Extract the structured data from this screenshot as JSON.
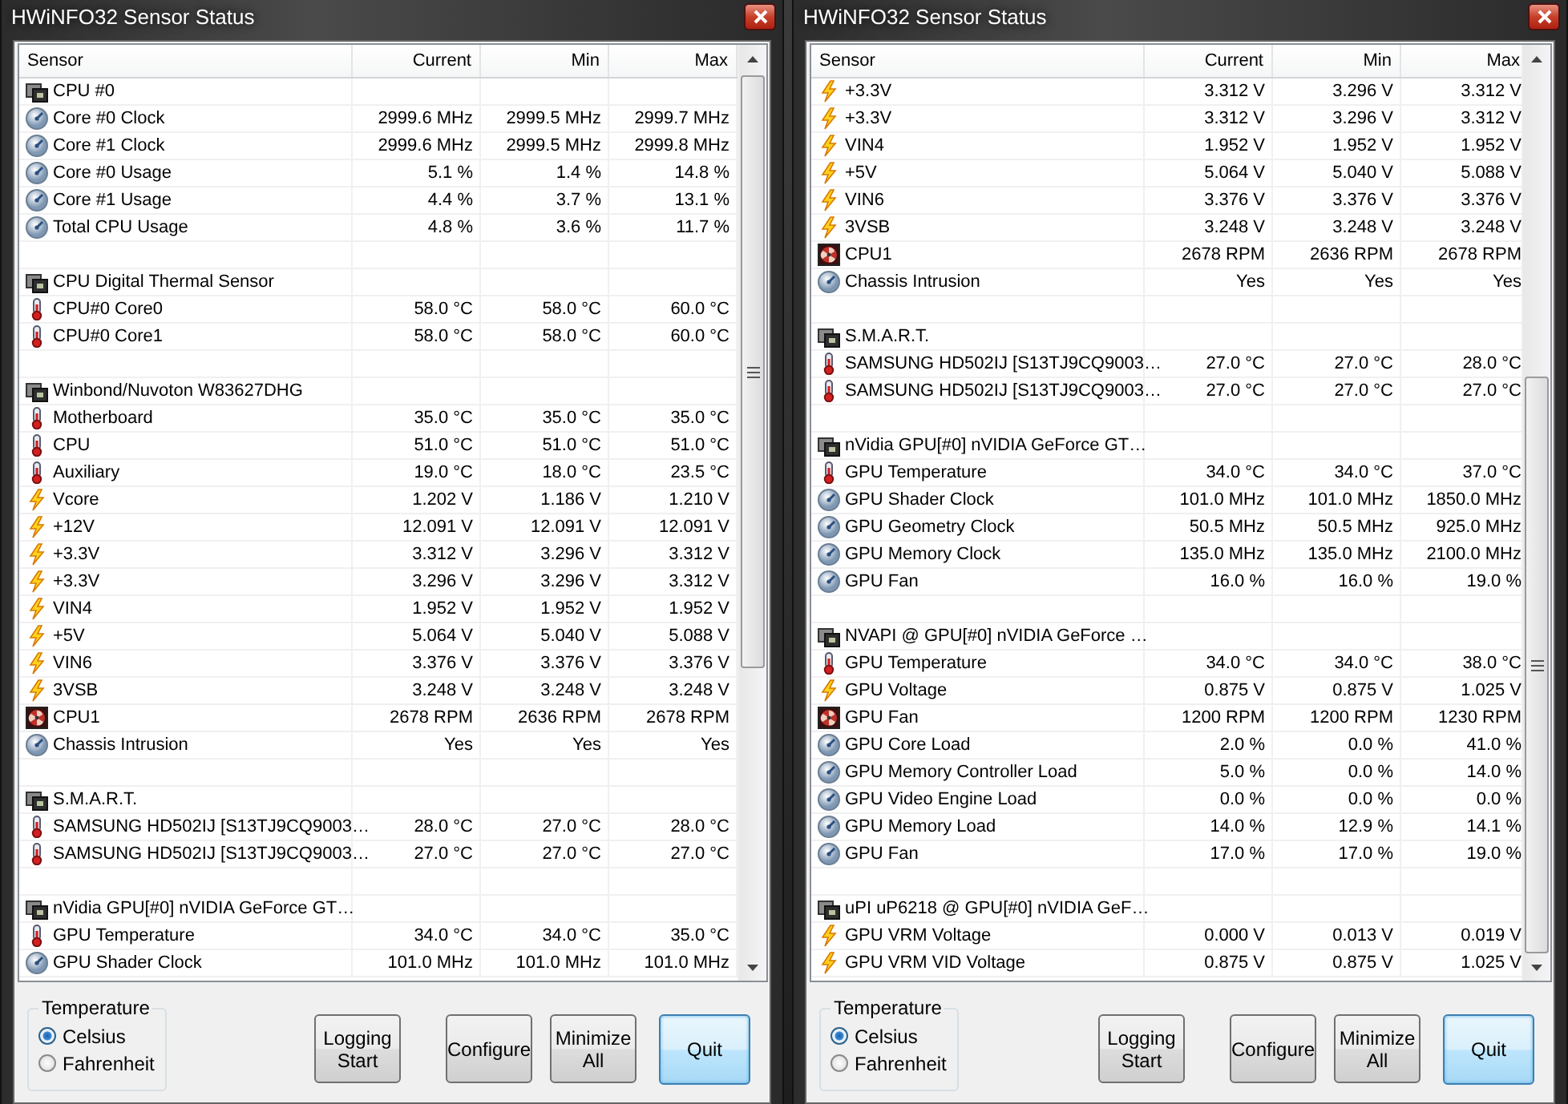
{
  "windows": [
    {
      "title": "HWiNFO32 Sensor Status",
      "columns": [
        "Sensor",
        "Current",
        "Min",
        "Max"
      ],
      "rows": [
        {
          "kind": "group",
          "label": "CPU #0"
        },
        {
          "kind": "gauge",
          "label": "Core #0 Clock",
          "values": [
            "2999.6 MHz",
            "2999.5 MHz",
            "2999.7 MHz"
          ]
        },
        {
          "kind": "gauge",
          "label": "Core #1 Clock",
          "values": [
            "2999.6 MHz",
            "2999.5 MHz",
            "2999.8 MHz"
          ]
        },
        {
          "kind": "gauge",
          "label": "Core #0 Usage",
          "values": [
            "5.1 %",
            "1.4 %",
            "14.8 %"
          ]
        },
        {
          "kind": "gauge",
          "label": "Core #1 Usage",
          "values": [
            "4.4 %",
            "3.7 %",
            "13.1 %"
          ]
        },
        {
          "kind": "gauge",
          "label": "Total CPU Usage",
          "values": [
            "4.8 %",
            "3.6 %",
            "11.7 %"
          ]
        },
        {
          "kind": "blank"
        },
        {
          "kind": "group",
          "label": "CPU Digital Thermal Sensor"
        },
        {
          "kind": "thermo",
          "label": "CPU#0 Core0",
          "values": [
            "58.0 °C",
            "58.0 °C",
            "60.0 °C"
          ]
        },
        {
          "kind": "thermo",
          "label": "CPU#0 Core1",
          "values": [
            "58.0 °C",
            "58.0 °C",
            "60.0 °C"
          ]
        },
        {
          "kind": "blank"
        },
        {
          "kind": "group",
          "label": "Winbond/Nuvoton W83627DHG"
        },
        {
          "kind": "thermo",
          "label": "Motherboard",
          "values": [
            "35.0 °C",
            "35.0 °C",
            "35.0 °C"
          ]
        },
        {
          "kind": "thermo",
          "label": "CPU",
          "values": [
            "51.0 °C",
            "51.0 °C",
            "51.0 °C"
          ]
        },
        {
          "kind": "thermo",
          "label": "Auxiliary",
          "values": [
            "19.0 °C",
            "18.0 °C",
            "23.5 °C"
          ]
        },
        {
          "kind": "volt",
          "label": "Vcore",
          "values": [
            "1.202 V",
            "1.186 V",
            "1.210 V"
          ]
        },
        {
          "kind": "volt",
          "label": "+12V",
          "values": [
            "12.091 V",
            "12.091 V",
            "12.091 V"
          ]
        },
        {
          "kind": "volt",
          "label": "+3.3V",
          "values": [
            "3.312 V",
            "3.296 V",
            "3.312 V"
          ]
        },
        {
          "kind": "volt",
          "label": "+3.3V",
          "values": [
            "3.296 V",
            "3.296 V",
            "3.312 V"
          ]
        },
        {
          "kind": "volt",
          "label": "VIN4",
          "values": [
            "1.952 V",
            "1.952 V",
            "1.952 V"
          ]
        },
        {
          "kind": "volt",
          "label": "+5V",
          "values": [
            "5.064 V",
            "5.040 V",
            "5.088 V"
          ]
        },
        {
          "kind": "volt",
          "label": "VIN6",
          "values": [
            "3.376 V",
            "3.376 V",
            "3.376 V"
          ]
        },
        {
          "kind": "volt",
          "label": "3VSB",
          "values": [
            "3.248 V",
            "3.248 V",
            "3.248 V"
          ]
        },
        {
          "kind": "fan",
          "label": "CPU1",
          "values": [
            "2678 RPM",
            "2636 RPM",
            "2678 RPM"
          ]
        },
        {
          "kind": "gauge",
          "label": "Chassis Intrusion",
          "values": [
            "Yes",
            "Yes",
            "Yes"
          ]
        },
        {
          "kind": "blank"
        },
        {
          "kind": "group",
          "label": "S.M.A.R.T."
        },
        {
          "kind": "thermo",
          "label": "SAMSUNG HD502IJ [S13TJ9CQ9003…",
          "values": [
            "28.0 °C",
            "27.0 °C",
            "28.0 °C"
          ]
        },
        {
          "kind": "thermo",
          "label": "SAMSUNG HD502IJ [S13TJ9CQ9003…",
          "values": [
            "27.0 °C",
            "27.0 °C",
            "27.0 °C"
          ]
        },
        {
          "kind": "blank"
        },
        {
          "kind": "group",
          "label": "nVidia GPU[#0] nVIDIA GeForce GT…"
        },
        {
          "kind": "thermo",
          "label": "GPU Temperature",
          "values": [
            "34.0 °C",
            "34.0 °C",
            "35.0 °C"
          ]
        },
        {
          "kind": "gauge",
          "label": "GPU Shader Clock",
          "values": [
            "101.0 MHz",
            "101.0 MHz",
            "101.0 MHz"
          ]
        }
      ],
      "temperature": {
        "label": "Temperature",
        "options": [
          {
            "label": "Celsius",
            "selected": true
          },
          {
            "label": "Fahrenheit",
            "selected": false
          }
        ]
      },
      "buttons": [
        {
          "lines": [
            "Logging",
            "Start"
          ],
          "focused": false
        },
        {
          "lines": [
            "Configure"
          ],
          "focused": false
        },
        {
          "lines": [
            "Minimize",
            "All"
          ],
          "focused": false
        },
        {
          "lines": [
            "Quit"
          ],
          "focused": true
        }
      ]
    },
    {
      "title": "HWiNFO32 Sensor Status",
      "columns": [
        "Sensor",
        "Current",
        "Min",
        "Max"
      ],
      "rows": [
        {
          "kind": "volt",
          "label": "+3.3V",
          "values": [
            "3.312 V",
            "3.296 V",
            "3.312 V"
          ]
        },
        {
          "kind": "volt",
          "label": "+3.3V",
          "values": [
            "3.312 V",
            "3.296 V",
            "3.312 V"
          ]
        },
        {
          "kind": "volt",
          "label": "VIN4",
          "values": [
            "1.952 V",
            "1.952 V",
            "1.952 V"
          ]
        },
        {
          "kind": "volt",
          "label": "+5V",
          "values": [
            "5.064 V",
            "5.040 V",
            "5.088 V"
          ]
        },
        {
          "kind": "volt",
          "label": "VIN6",
          "values": [
            "3.376 V",
            "3.376 V",
            "3.376 V"
          ]
        },
        {
          "kind": "volt",
          "label": "3VSB",
          "values": [
            "3.248 V",
            "3.248 V",
            "3.248 V"
          ]
        },
        {
          "kind": "fan",
          "label": "CPU1",
          "values": [
            "2678 RPM",
            "2636 RPM",
            "2678 RPM"
          ]
        },
        {
          "kind": "gauge",
          "label": "Chassis Intrusion",
          "values": [
            "Yes",
            "Yes",
            "Yes"
          ]
        },
        {
          "kind": "blank"
        },
        {
          "kind": "group",
          "label": "S.M.A.R.T."
        },
        {
          "kind": "thermo",
          "label": "SAMSUNG HD502IJ [S13TJ9CQ9003…",
          "values": [
            "27.0 °C",
            "27.0 °C",
            "28.0 °C"
          ]
        },
        {
          "kind": "thermo",
          "label": "SAMSUNG HD502IJ [S13TJ9CQ9003…",
          "values": [
            "27.0 °C",
            "27.0 °C",
            "27.0 °C"
          ]
        },
        {
          "kind": "blank"
        },
        {
          "kind": "group",
          "label": "nVidia GPU[#0] nVIDIA GeForce GT…"
        },
        {
          "kind": "thermo",
          "label": "GPU Temperature",
          "values": [
            "34.0 °C",
            "34.0 °C",
            "37.0 °C"
          ]
        },
        {
          "kind": "gauge",
          "label": "GPU Shader Clock",
          "values": [
            "101.0 MHz",
            "101.0 MHz",
            "1850.0 MHz"
          ]
        },
        {
          "kind": "gauge",
          "label": "GPU Geometry Clock",
          "values": [
            "50.5 MHz",
            "50.5 MHz",
            "925.0 MHz"
          ]
        },
        {
          "kind": "gauge",
          "label": "GPU Memory Clock",
          "values": [
            "135.0 MHz",
            "135.0 MHz",
            "2100.0 MHz"
          ]
        },
        {
          "kind": "gauge",
          "label": "GPU Fan",
          "values": [
            "16.0 %",
            "16.0 %",
            "19.0 %"
          ]
        },
        {
          "kind": "blank"
        },
        {
          "kind": "group",
          "label": "NVAPI @ GPU[#0] nVIDIA GeForce …"
        },
        {
          "kind": "thermo",
          "label": "GPU Temperature",
          "values": [
            "34.0 °C",
            "34.0 °C",
            "38.0 °C"
          ]
        },
        {
          "kind": "volt",
          "label": "GPU Voltage",
          "values": [
            "0.875 V",
            "0.875 V",
            "1.025 V"
          ]
        },
        {
          "kind": "fan",
          "label": "GPU Fan",
          "values": [
            "1200 RPM",
            "1200 RPM",
            "1230 RPM"
          ]
        },
        {
          "kind": "gauge",
          "label": "GPU Core Load",
          "values": [
            "2.0 %",
            "0.0 %",
            "41.0 %"
          ]
        },
        {
          "kind": "gauge",
          "label": "GPU Memory Controller Load",
          "values": [
            "5.0 %",
            "0.0 %",
            "14.0 %"
          ]
        },
        {
          "kind": "gauge",
          "label": "GPU Video Engine Load",
          "values": [
            "0.0 %",
            "0.0 %",
            "0.0 %"
          ]
        },
        {
          "kind": "gauge",
          "label": "GPU Memory Load",
          "values": [
            "14.0 %",
            "12.9 %",
            "14.1 %"
          ]
        },
        {
          "kind": "gauge",
          "label": "GPU Fan",
          "values": [
            "17.0 %",
            "17.0 %",
            "19.0 %"
          ]
        },
        {
          "kind": "blank"
        },
        {
          "kind": "group",
          "label": "uPI uP6218 @ GPU[#0] nVIDIA GeF…"
        },
        {
          "kind": "volt",
          "label": "GPU VRM Voltage",
          "values": [
            "0.000 V",
            "0.013 V",
            "0.019 V"
          ]
        },
        {
          "kind": "volt",
          "label": "GPU VRM VID Voltage",
          "values": [
            "0.875 V",
            "0.875 V",
            "1.025 V"
          ]
        }
      ],
      "temperature": {
        "label": "Temperature",
        "options": [
          {
            "label": "Celsius",
            "selected": true
          },
          {
            "label": "Fahrenheit",
            "selected": false
          }
        ]
      },
      "buttons": [
        {
          "lines": [
            "Logging",
            "Start"
          ],
          "focused": false
        },
        {
          "lines": [
            "Configure"
          ],
          "focused": false
        },
        {
          "lines": [
            "Minimize",
            "All"
          ],
          "focused": false
        },
        {
          "lines": [
            "Quit"
          ],
          "focused": true
        }
      ]
    }
  ]
}
